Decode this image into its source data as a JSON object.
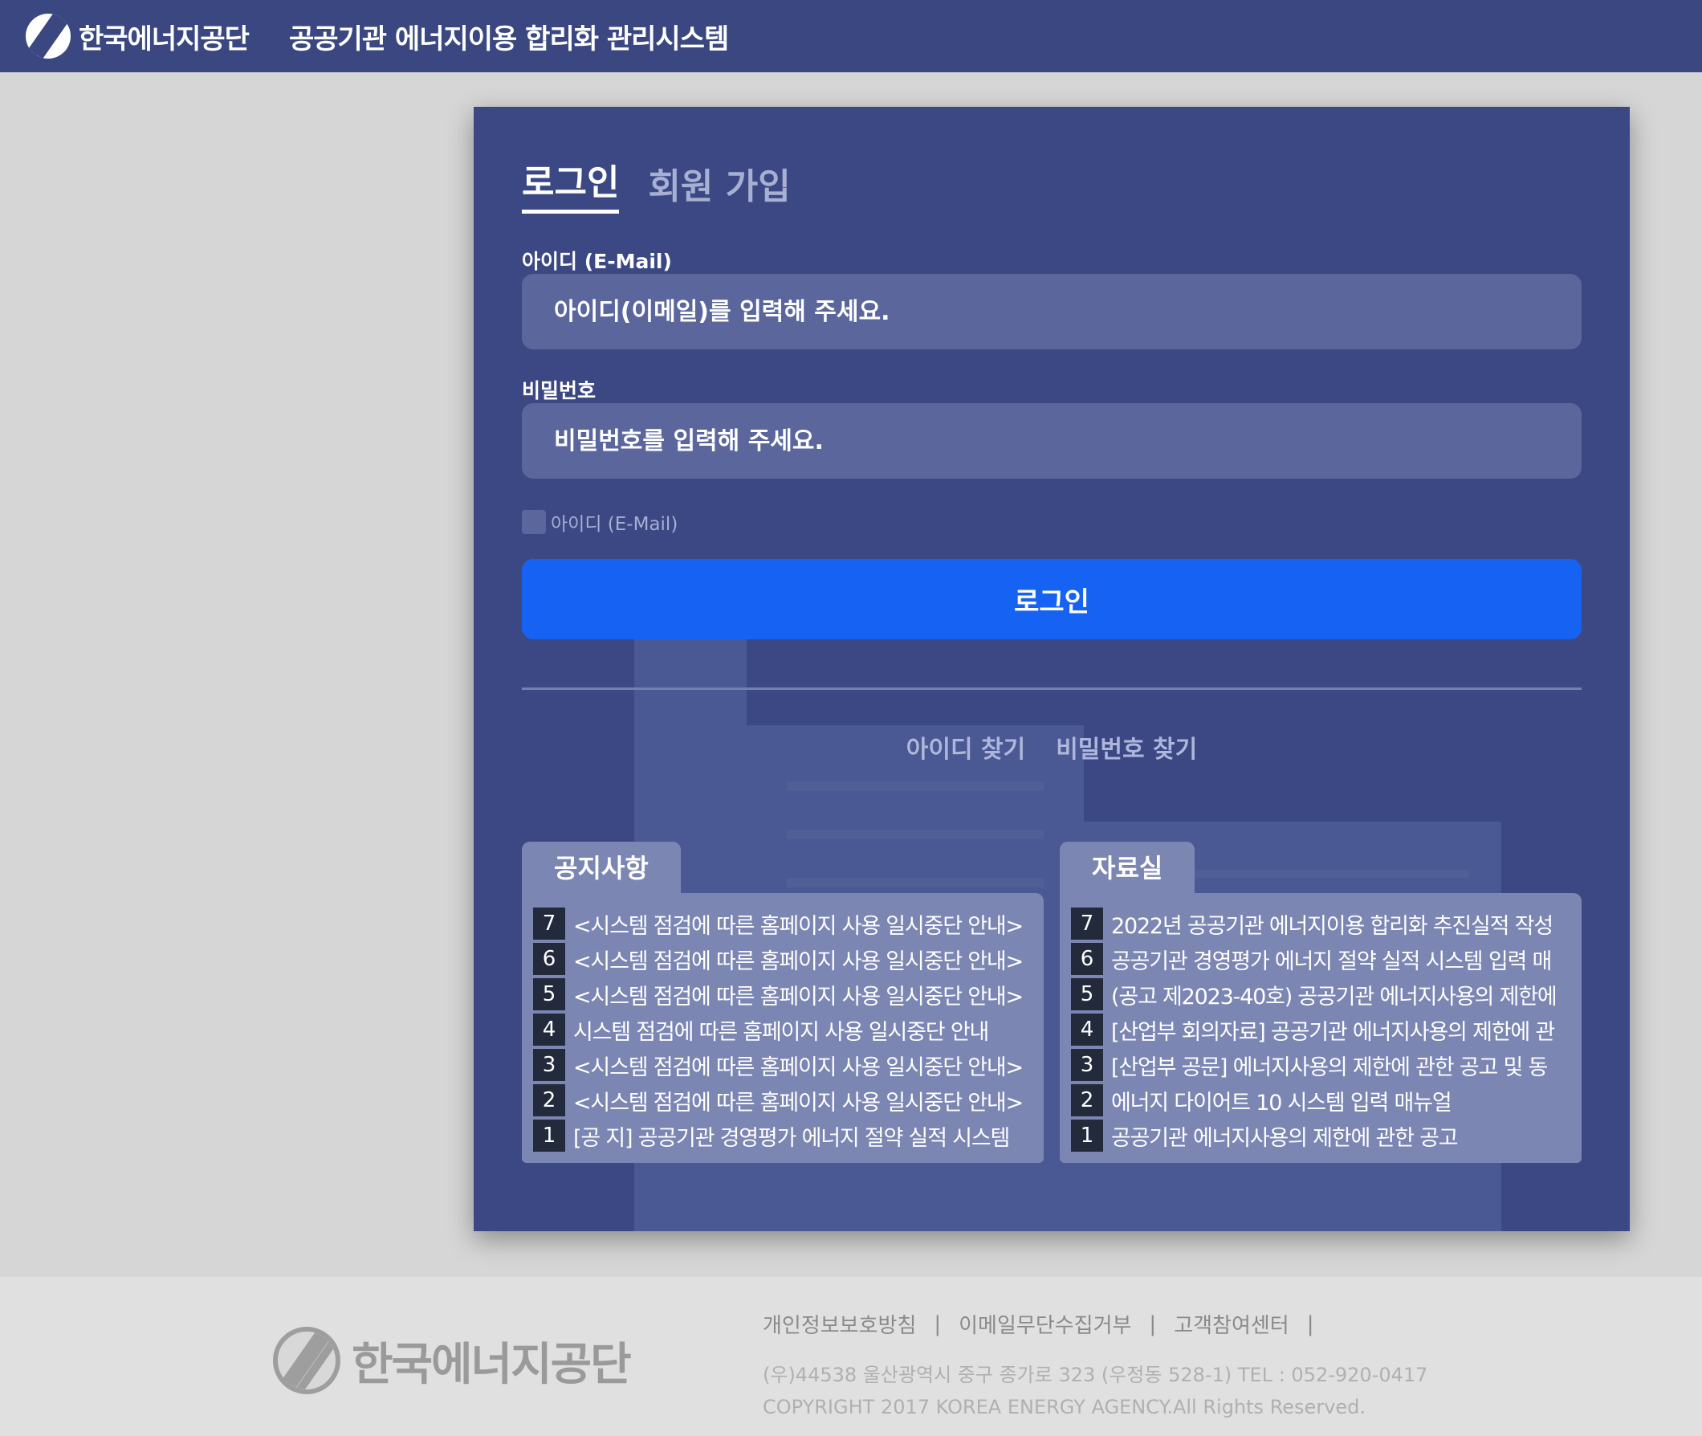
{
  "header": {
    "logo_text": "한국에너지공단",
    "system_title": "공공기관 에너지이용 합리화 관리시스템"
  },
  "tabs": [
    {
      "label": "로그인",
      "active": true
    },
    {
      "label": "회원 가입",
      "active": false
    }
  ],
  "form": {
    "id_label": "아이디 (E-Mail)",
    "id_placeholder": "아이디(이메일)를 입력해 주세요.",
    "password_label": "비밀번호",
    "password_placeholder": "비밀번호를 입력해 주세요.",
    "remember_label": "아이디 (E-Mail)",
    "remember_checked": false,
    "login_button": "로그인"
  },
  "find": {
    "find_id": "아이디 찾기",
    "find_password": "비밀번호 찾기"
  },
  "notices": {
    "title": "공지사항",
    "items": [
      {
        "num": "7",
        "title": "<시스템 점검에 따른 홈페이지 사용 일시중단 안내>"
      },
      {
        "num": "6",
        "title": "<시스템 점검에 따른 홈페이지 사용 일시중단 안내>"
      },
      {
        "num": "5",
        "title": "<시스템 점검에 따른 홈페이지 사용 일시중단 안내>"
      },
      {
        "num": "4",
        "title": "시스템 점검에 따른 홈페이지 사용 일시중단 안내"
      },
      {
        "num": "3",
        "title": "<시스템 점검에 따른 홈페이지 사용 일시중단 안내>"
      },
      {
        "num": "2",
        "title": "<시스템 점검에 따른 홈페이지 사용 일시중단 안내>"
      },
      {
        "num": "1",
        "title": "[공 지] 공공기관 경영평가 에너지 절약 실적 시스템 "
      }
    ]
  },
  "archive": {
    "title": "자료실",
    "items": [
      {
        "num": "7",
        "title": "2022년 공공기관 에너지이용 합리화 추진실적 작성"
      },
      {
        "num": "6",
        "title": "공공기관 경영평가 에너지 절약 실적 시스템 입력 매"
      },
      {
        "num": "5",
        "title": "(공고 제2023-40호) 공공기관 에너지사용의 제한에"
      },
      {
        "num": "4",
        "title": "[산업부 회의자료] 공공기관 에너지사용의 제한에 관"
      },
      {
        "num": "3",
        "title": "[산업부 공문] 에너지사용의 제한에 관한 공고 및 동"
      },
      {
        "num": "2",
        "title": "에너지 다이어트 10 시스템 입력 매뉴얼"
      },
      {
        "num": "1",
        "title": "공공기관 에너지사용의 제한에 관한 공고"
      }
    ]
  },
  "footer": {
    "logo_text": "한국에너지공단",
    "links": [
      "개인정보보호방침",
      "이메일무단수집거부",
      "고객참여센터"
    ],
    "address": "(우)44538 울산광역시 중구 종가로 323 (우정동 528-1) TEL : 052-920-0417",
    "copyright": "COPYRIGHT 2017 KOREA ENERGY AGENCY.All Rights Reserved."
  },
  "colors": {
    "header_bg": "#3a4780",
    "panel_bg": "#3b4884",
    "primary_button": "#1663f3",
    "board_bg": "#7c86b2"
  }
}
